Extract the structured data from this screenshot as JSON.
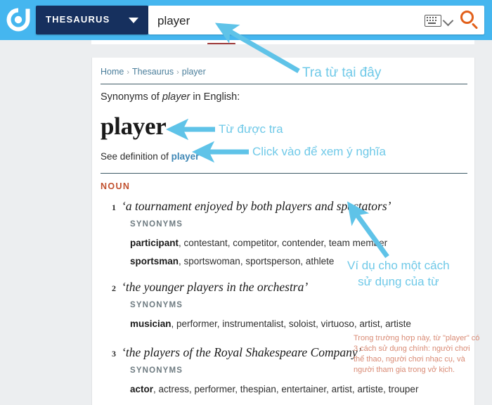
{
  "header": {
    "logo_icon": "dictionary-circle-logo",
    "dictionary_selector_label": "THESAURUS",
    "dropdown_icon": "caret-down-icon",
    "search_value": "player",
    "search_placeholder": "",
    "keyboard_icon": "keyboard-icon",
    "keyboard_caret_icon": "chevron-down-icon",
    "search_button_icon": "search-icon",
    "bg_color": "#45b6ef",
    "selector_color": "#16305e",
    "search_icon_color": "#e2601a"
  },
  "breadcrumb": {
    "home": "Home",
    "sep": "›",
    "section": "Thesaurus",
    "current": "player"
  },
  "entry": {
    "synonyms_prefix": "Synonyms of ",
    "synonyms_word": "player",
    "synonyms_suffix": " in English:",
    "headword": "player",
    "see_definition_prefix": "See definition of ",
    "see_definition_link": "player",
    "part_of_speech": "NOUN",
    "synonyms_label": "SYNONYMS"
  },
  "senses": [
    {
      "number": "1",
      "quote": "‘a tournament enjoyed by both players and spectators’",
      "label": "SYNONYMS",
      "lines": [
        {
          "bold": "participant",
          "rest": ", contestant, competitor, contender, team member"
        },
        {
          "bold": "sportsman",
          "rest": ", sportswoman, sportsperson, athlete"
        }
      ]
    },
    {
      "number": "2",
      "quote": "‘the younger players in the orchestra’",
      "label": "SYNONYMS",
      "lines": [
        {
          "bold": "musician",
          "rest": ", performer, instrumentalist, soloist, virtuoso, artist, artiste"
        }
      ]
    },
    {
      "number": "3",
      "quote": "‘the players of the Royal Shakespeare Company’",
      "label": "SYNONYMS",
      "lines": [
        {
          "bold": "actor",
          "rest": ", actress, performer, thespian, entertainer, artist, artiste, trouper"
        }
      ]
    }
  ],
  "annotations": {
    "color": "#6fc9e8",
    "note_color": "#d98a74",
    "a1": "Tra từ tại đây",
    "a2": "Từ được tra",
    "a3": "Click vào để xem ý nghĩa",
    "a4": "Ví dụ cho một cách\nsử dụng của từ",
    "a5": "Trong trường hợp này, từ \"player\" có 3 cách sử dụng chính: người chơi thể thao, người chơi nhạc cụ, và người tham gia trong vở kịch."
  }
}
